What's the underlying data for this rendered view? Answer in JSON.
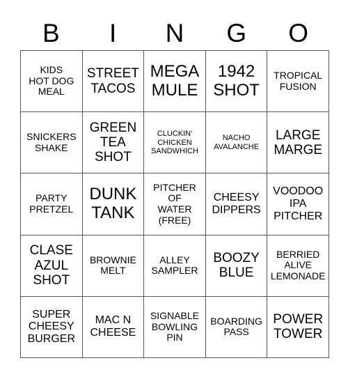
{
  "header": [
    "B",
    "I",
    "N",
    "G",
    "O"
  ],
  "cells": [
    {
      "text": "KIDS\nHOT DOG\nMEAL",
      "size": "s2"
    },
    {
      "text": "STREET\nTACOS",
      "size": "s4"
    },
    {
      "text": "MEGA\nMULE",
      "size": "s5"
    },
    {
      "text": "1942\nSHOT",
      "size": "s5"
    },
    {
      "text": "TROPICAL\nFUSION",
      "size": "s2"
    },
    {
      "text": "SNICKERS\nSHAKE",
      "size": "s2"
    },
    {
      "text": "GREEN\nTEA\nSHOT",
      "size": "s4"
    },
    {
      "text": "CLUCKIN'\nCHICKEN\nSANDWHICH",
      "size": "s1"
    },
    {
      "text": "NACHO\nAVALANCHE",
      "size": "s1"
    },
    {
      "text": "LARGE\nMARGE",
      "size": "s4"
    },
    {
      "text": "PARTY\nPRETZEL",
      "size": "s2"
    },
    {
      "text": "DUNK\nTANK",
      "size": "s5"
    },
    {
      "text": "PITCHER\nOF\nWATER\n(FREE)",
      "size": "s2"
    },
    {
      "text": "CHEESY\nDIPPERS",
      "size": "s3"
    },
    {
      "text": "VOODOO\nIPA\nPITCHER",
      "size": "s3"
    },
    {
      "text": "CLASE\nAZUL\nSHOT",
      "size": "s4"
    },
    {
      "text": "BROWNIE\nMELT",
      "size": "s2"
    },
    {
      "text": "ALLEY\nSAMPLER",
      "size": "s2"
    },
    {
      "text": "BOOZY\nBLUE",
      "size": "s4"
    },
    {
      "text": "BERRIED\nALIVE\nLEMONADE",
      "size": "s2"
    },
    {
      "text": "SUPER\nCHEESY\nBURGER",
      "size": "s3"
    },
    {
      "text": "MAC N\nCHEESE",
      "size": "s3"
    },
    {
      "text": "SIGNABLE\nBOWLING\nPIN",
      "size": "s2"
    },
    {
      "text": "BOARDING\nPASS",
      "size": "s2"
    },
    {
      "text": "POWER\nTOWER",
      "size": "s4"
    }
  ]
}
